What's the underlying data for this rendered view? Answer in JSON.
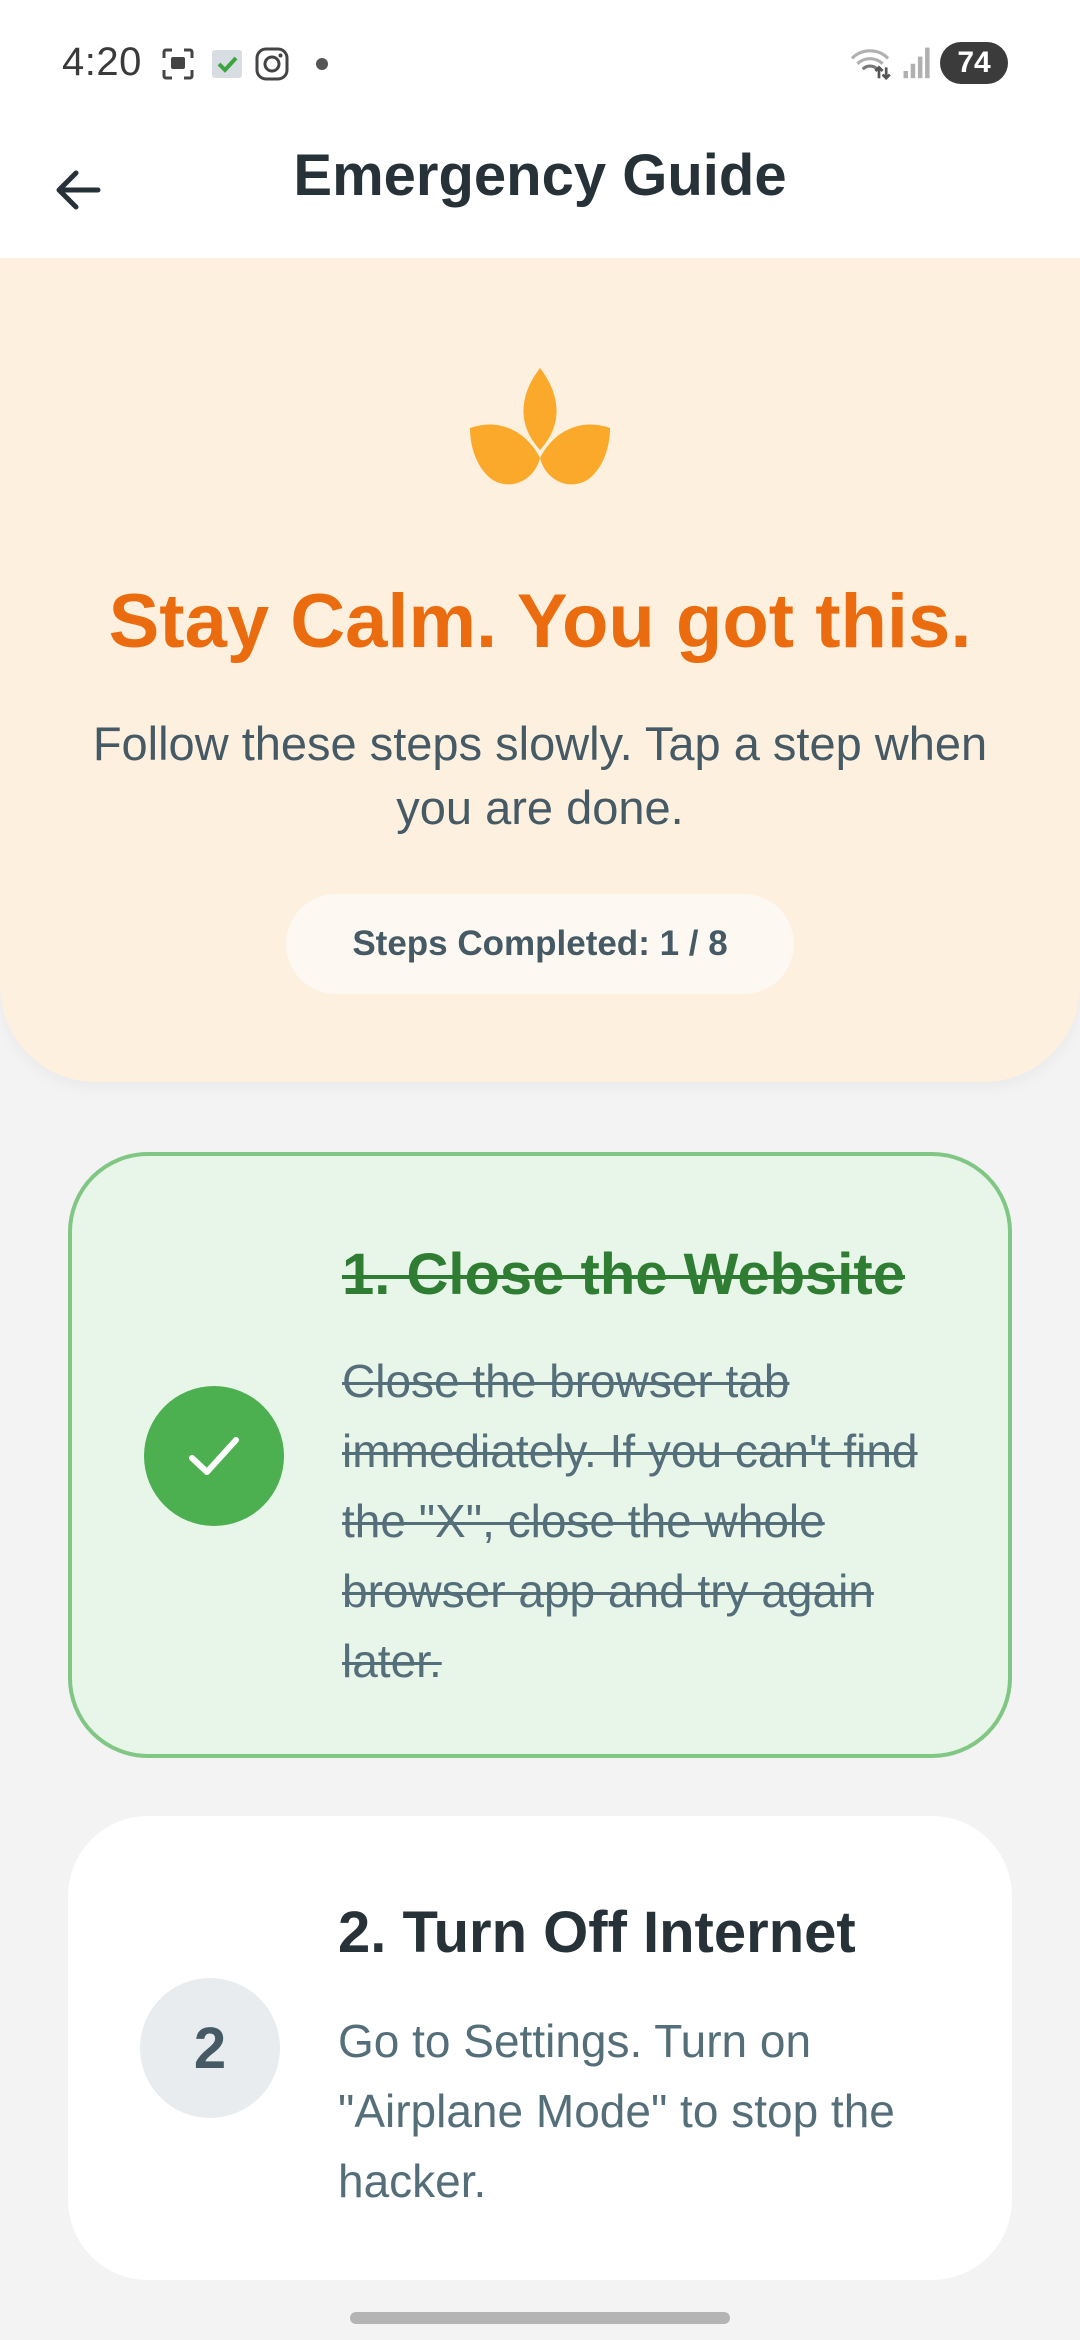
{
  "status_bar": {
    "time": "4:20",
    "battery": "74",
    "icons": [
      "screenshot-icon",
      "security-app-icon",
      "instagram-icon",
      "notification-dot-icon",
      "wifi-icon",
      "signal-icon",
      "battery-icon"
    ]
  },
  "app_bar": {
    "title": "Emergency Guide",
    "back_icon": "arrow-back-icon"
  },
  "hero": {
    "icon": "lotus-icon",
    "title": "Stay Calm. You got this.",
    "subtitle": "Follow these steps slowly. Tap a step when you are done.",
    "progress_label": "Steps Completed: 1 / 8",
    "completed": 1,
    "total": 8
  },
  "steps": [
    {
      "title": "1. Close the Website",
      "description": "Close the browser tab immediately. If you can't find the \"X\", close the whole browser app and try again later.",
      "status": "done",
      "badge_icon": "checkmark-icon"
    },
    {
      "title": "2. Turn Off Internet",
      "description": "Go to Settings. Turn on \"Airplane Mode\" to stop the hacker.",
      "status": "todo",
      "badge": "2"
    }
  ],
  "colors": {
    "accent_orange": "#ea6c0f",
    "lotus_orange": "#fba92b",
    "hero_bg": "#fdf0df",
    "done_green": "#4caf50",
    "done_bg": "#e8f5e9",
    "done_border": "#81c784",
    "page_bg": "#f3f3f4",
    "text_dark": "#263238"
  }
}
